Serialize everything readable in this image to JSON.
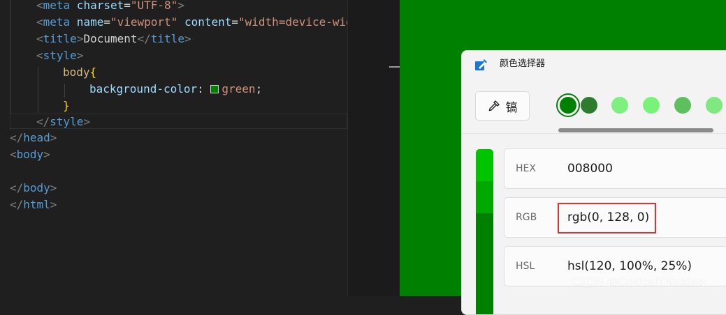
{
  "editor": {
    "lines": {
      "l1": {
        "open": "<",
        "tag": "meta",
        "attr": " charset",
        "eq": "=",
        "str": "\"UTF-8\"",
        "close": ">"
      },
      "l2": {
        "open": "<",
        "tag": "meta",
        "attr1": " name",
        "eq1": "=",
        "str1": "\"viewport\"",
        "attr2": " content",
        "eq2": "=",
        "str2": "\"width=device-wid"
      },
      "l3": {
        "open": "<",
        "tag": "title",
        "close": ">",
        "text": "Document",
        "endopen": "</",
        "endtag": "title",
        "endclose": ">"
      },
      "l4": {
        "open": "<",
        "tag": "style",
        "close": ">"
      },
      "l5": {
        "selector": "body",
        "brace": "{"
      },
      "l6": {
        "prop": "background-color",
        "colon": ": ",
        "value": "green",
        "semi": ";"
      },
      "l7": {
        "brace": "}"
      },
      "l8": {
        "open": "</",
        "tag": "style",
        "close": ">"
      },
      "l9": {
        "open": "</",
        "tag": "head",
        "close": ">"
      },
      "l10": {
        "open": "<",
        "tag": "body",
        "close": ">"
      },
      "l12": {
        "open": "</",
        "tag": "body",
        "close": ">"
      },
      "l13": {
        "open": "</",
        "tag": "html",
        "close": ">"
      }
    }
  },
  "preview": {
    "background": "#008000"
  },
  "picker": {
    "title": "颜色选择器",
    "eyedropper_label": "镐",
    "swatches": [
      "#008000",
      "#2e7d2e",
      "#7df07d",
      "#79f279",
      "#5dbf5d",
      "#7fe87f"
    ],
    "selected_swatch": 0,
    "fields": {
      "hex": {
        "label": "HEX",
        "value": "008000"
      },
      "rgb": {
        "label": "RGB",
        "value": "rgb(0, 128, 0)"
      },
      "hsl": {
        "label": "HSL",
        "value": "hsl(120, 100%, 25%)"
      }
    }
  },
  "watermark": "CSDN @CriticalThinking"
}
